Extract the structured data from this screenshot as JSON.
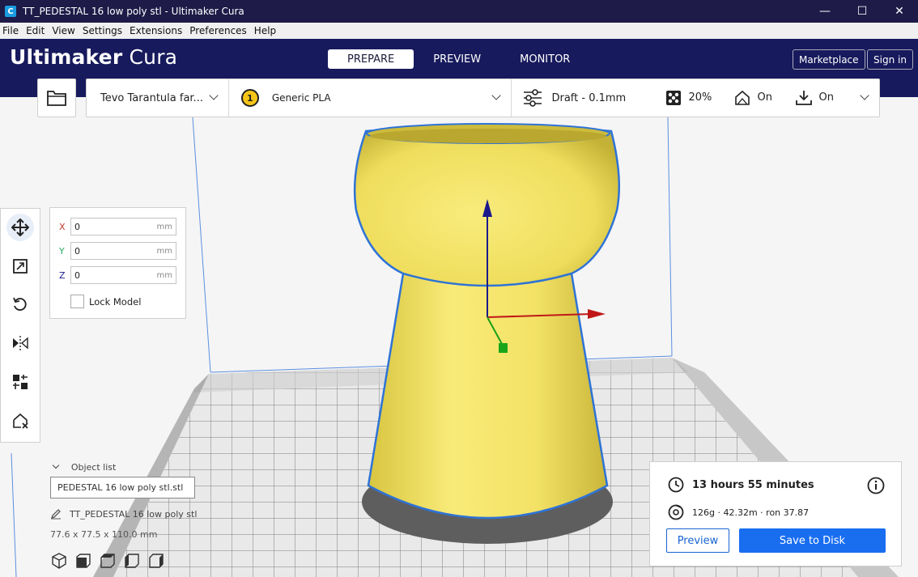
{
  "window": {
    "title": "TT_PEDESTAL 16 low poly stl - Ultimaker Cura",
    "app_icon_glyph": "C"
  },
  "menu": [
    "File",
    "Edit",
    "View",
    "Settings",
    "Extensions",
    "Preferences",
    "Help"
  ],
  "header": {
    "brand_bold": "Ultimaker",
    "brand_light": " Cura",
    "stages": [
      "PREPARE",
      "PREVIEW",
      "MONITOR"
    ],
    "active_stage": "PREPARE",
    "marketplace_label": "Marketplace",
    "signin_label": "Sign in"
  },
  "setup": {
    "printer": "Tevo Tarantula far...",
    "extruder_number": "1",
    "material": "Generic PLA",
    "profile": "Draft - 0.1mm",
    "infill": "20%",
    "support": "On",
    "adhesion": "On"
  },
  "move_panel": {
    "x_label": "X",
    "y_label": "Y",
    "z_label": "Z",
    "x_value": "0",
    "y_value": "0",
    "z_value": "0",
    "unit": "mm",
    "lock_label": "Lock Model"
  },
  "object_list": {
    "header": "Object list",
    "field_value": "PEDESTAL 16 low poly stl.stl",
    "model_name": "TT_PEDESTAL 16 low poly stl",
    "dimensions": "77.6 x 77.5 x 110.0 mm"
  },
  "print_info": {
    "time": "13 hours 55 minutes",
    "material_usage": "126g · 42.32m · ron 37.87",
    "preview_label": "Preview",
    "save_label": "Save to Disk"
  },
  "colors": {
    "header_bg": "#171a5c",
    "titlebar_bg": "#1e1b48",
    "accent_blue": "#196ef0",
    "model_yellow": "#f2e06a"
  }
}
